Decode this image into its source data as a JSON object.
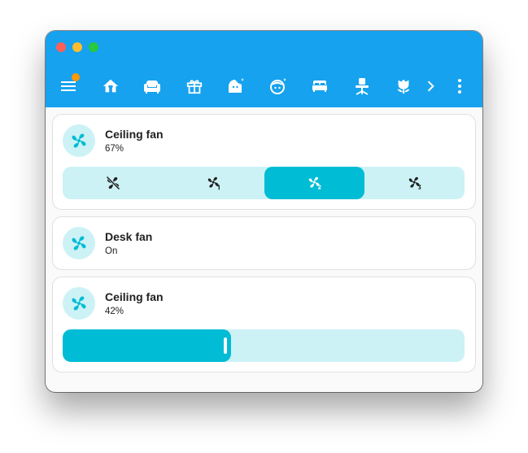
{
  "toolbar": {
    "tabs": [
      {
        "icon": "home-heart-icon"
      },
      {
        "icon": "sofa-icon"
      },
      {
        "icon": "gift-icon"
      },
      {
        "icon": "face-woman-shimmer-icon"
      },
      {
        "icon": "face-man-shimmer-icon"
      },
      {
        "icon": "bed-icon"
      },
      {
        "icon": "desk-chair-icon"
      },
      {
        "icon": "flower-tulip-icon"
      }
    ],
    "menu_icon": "menu-icon",
    "notification_color": "#ff9800",
    "scroll_icon": "chevron-right-icon",
    "overflow_icon": "dots-vertical-icon"
  },
  "cards": [
    {
      "name": "Ceiling fan",
      "state": "67%",
      "modes": [
        {
          "icon": "fan-off-icon",
          "active": false
        },
        {
          "icon": "fan-speed-1-icon",
          "active": false
        },
        {
          "icon": "fan-speed-2-icon",
          "active": true
        },
        {
          "icon": "fan-speed-3-icon",
          "active": false
        }
      ]
    },
    {
      "name": "Desk fan",
      "state": "On"
    },
    {
      "name": "Ceiling fan",
      "state": "42%",
      "slider_value": 0.42
    }
  ],
  "colors": {
    "app_bar": "#16a2ee",
    "accent": "#00bcd4",
    "accent_soft": "rgba(0,188,212,0.2)",
    "text": "#212121"
  }
}
